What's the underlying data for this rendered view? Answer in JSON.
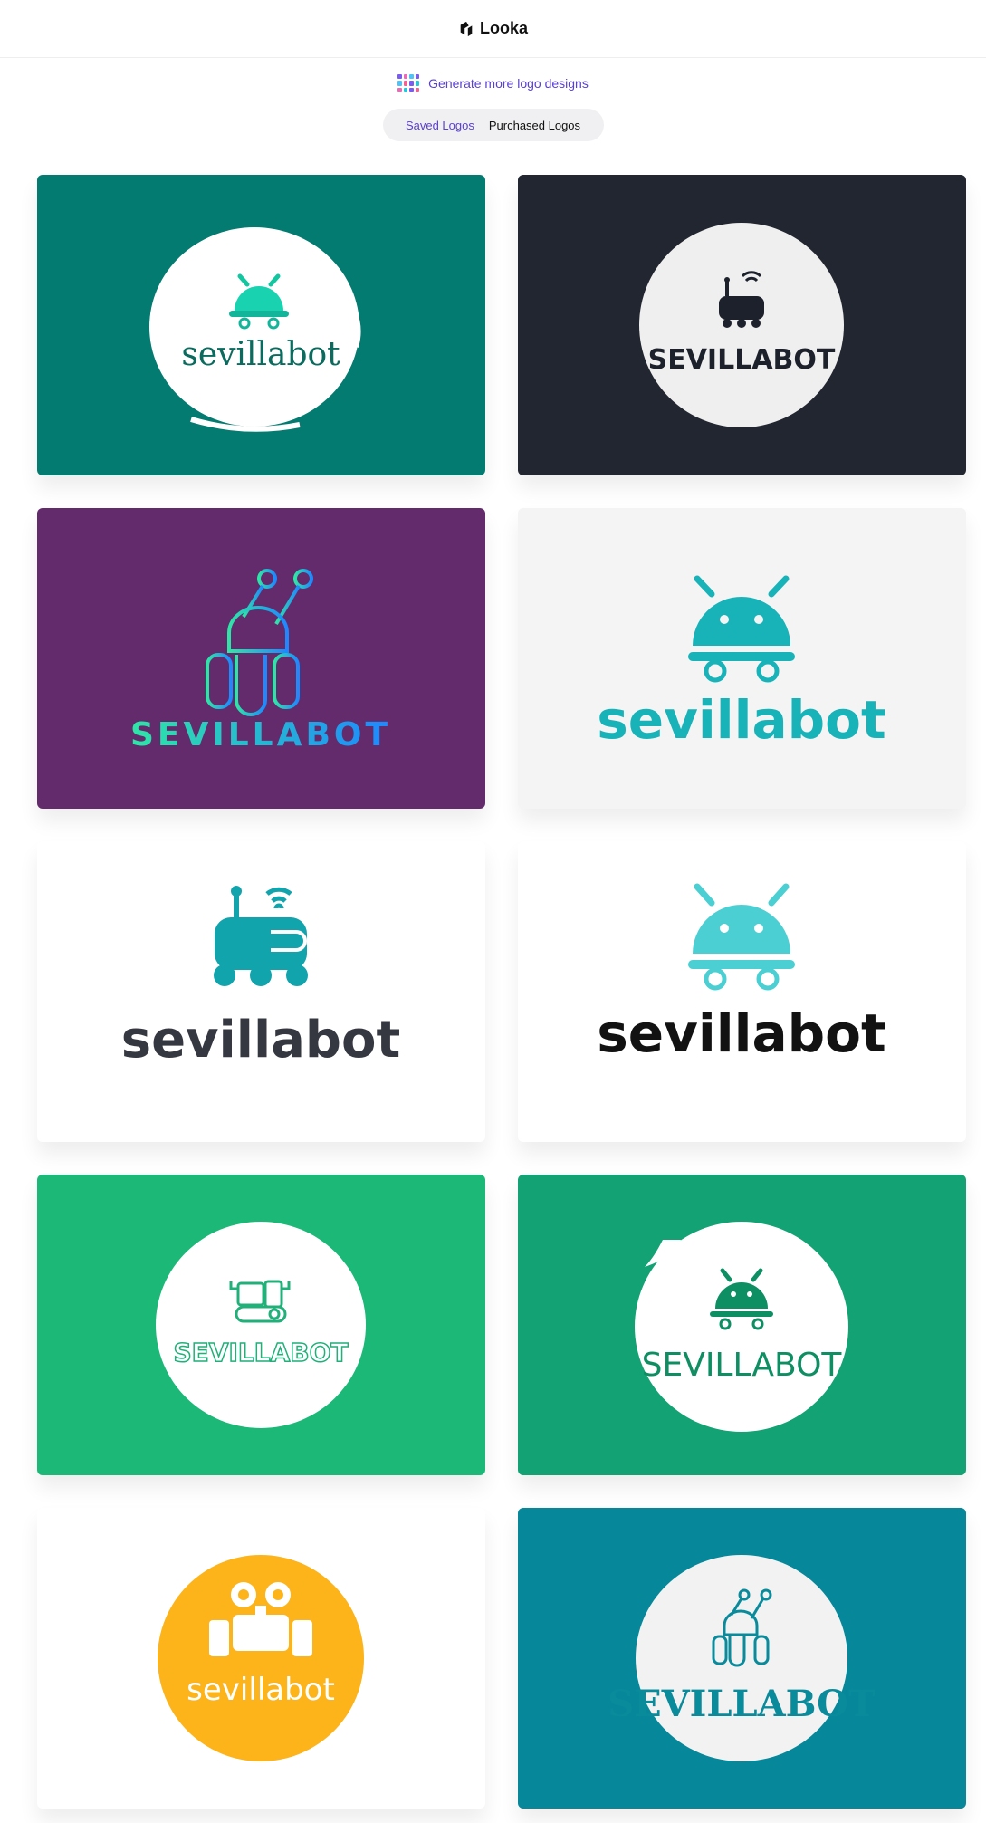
{
  "header": {
    "brand": "Looka",
    "brand_icon": "looka-logo-icon"
  },
  "generate_link": {
    "label": "Generate more logo designs",
    "icon": "logo-grid-icon"
  },
  "tabs": [
    {
      "label": "Saved Logos",
      "active": true
    },
    {
      "label": "Purchased Logos",
      "active": false
    }
  ],
  "logos": [
    {
      "name": "sevillabot",
      "bg": "#037b70",
      "text_color": "#0a6b5e",
      "style": "brush-circle"
    },
    {
      "name": "SEVILLABOT",
      "bg": "#222630",
      "text_color": "#1d212b",
      "style": "circle-dark"
    },
    {
      "name": "SEVILLABOT",
      "bg": "#632b6c",
      "text_color": "#2ee6a6",
      "style": "outline-robot"
    },
    {
      "name": "sevillabot",
      "bg": "#f4f4f4",
      "text_color": "#17b3b9",
      "style": "flat"
    },
    {
      "name": "sevillabot",
      "bg": "#ffffff",
      "text_color": "#353841",
      "style": "rover"
    },
    {
      "name": "sevillabot",
      "bg": "#ffffff",
      "text_color": "#121212",
      "style": "flat-bold"
    },
    {
      "name": "SEVILLABOT",
      "bg": "#1bb877",
      "text_color": "#22b07a",
      "style": "circle-tank"
    },
    {
      "name": "SEVILLABOT",
      "bg": "#13a273",
      "text_color": "#0e8f63",
      "style": "circle-rover"
    },
    {
      "name": "sevillabot",
      "bg": "#ffffff",
      "text_color": "#ffffff",
      "style": "yellow-walle"
    },
    {
      "name": "SEVILLABOT",
      "bg": "#06879a",
      "text_color": "#0a8b9c",
      "style": "circle-antenna"
    }
  ]
}
